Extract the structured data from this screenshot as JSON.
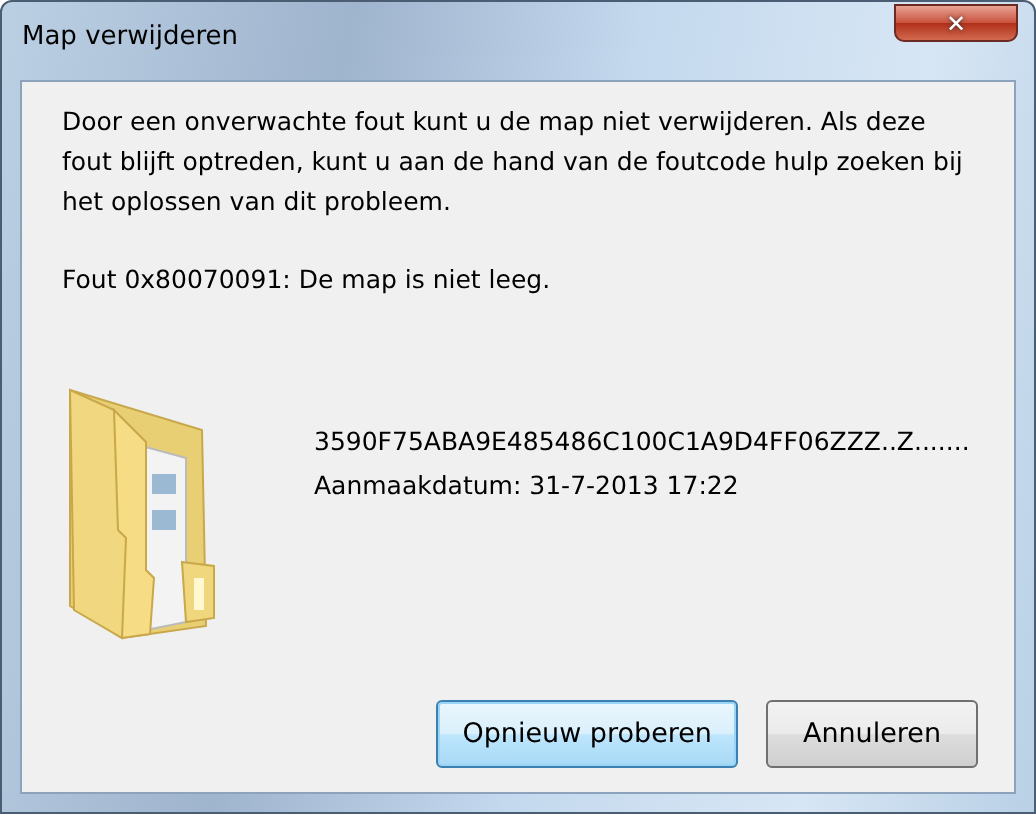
{
  "window": {
    "title": "Map verwijderen",
    "close": "✕"
  },
  "message": "Door een onverwachte fout kunt u de map niet verwijderen. Als deze fout blijft optreden, kunt u aan de hand van de foutcode hulp zoeken bij het oplossen van dit probleem.",
  "error": "Fout 0x80070091: De map is niet leeg.",
  "item": {
    "name": "3590F75ABA9E485486C100C1A9D4FF06ZZZ..Z.......",
    "created": "Aanmaakdatum: 31-7-2013 17:22"
  },
  "buttons": [
    {
      "label": "Opnieuw proberen",
      "default": true
    },
    {
      "label": "Annuleren",
      "default": false
    }
  ]
}
